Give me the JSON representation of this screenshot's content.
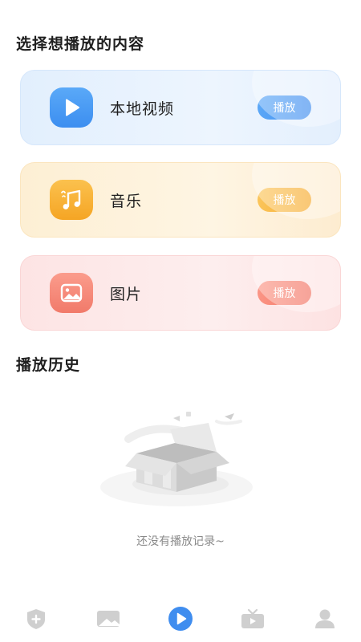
{
  "sections": {
    "choose_title": "选择想播放的内容",
    "history_title": "播放历史"
  },
  "cards": [
    {
      "label": "本地视频",
      "button": "播放",
      "icon": "play-icon",
      "color": "#3f8def"
    },
    {
      "label": "音乐",
      "button": "播放",
      "icon": "music-note-icon",
      "color": "#f6aa2c"
    },
    {
      "label": "图片",
      "button": "播放",
      "icon": "image-icon",
      "color": "#f27262"
    }
  ],
  "history": {
    "empty_text": "还没有播放记录~"
  },
  "tabbar": {
    "items": [
      {
        "icon": "shield-plus-icon",
        "active": false
      },
      {
        "icon": "picture-frame-icon",
        "active": false
      },
      {
        "icon": "play-circle-icon",
        "active": true,
        "color": "#3f8def"
      },
      {
        "icon": "tv-icon",
        "active": false
      },
      {
        "icon": "user-icon",
        "active": false
      }
    ]
  }
}
